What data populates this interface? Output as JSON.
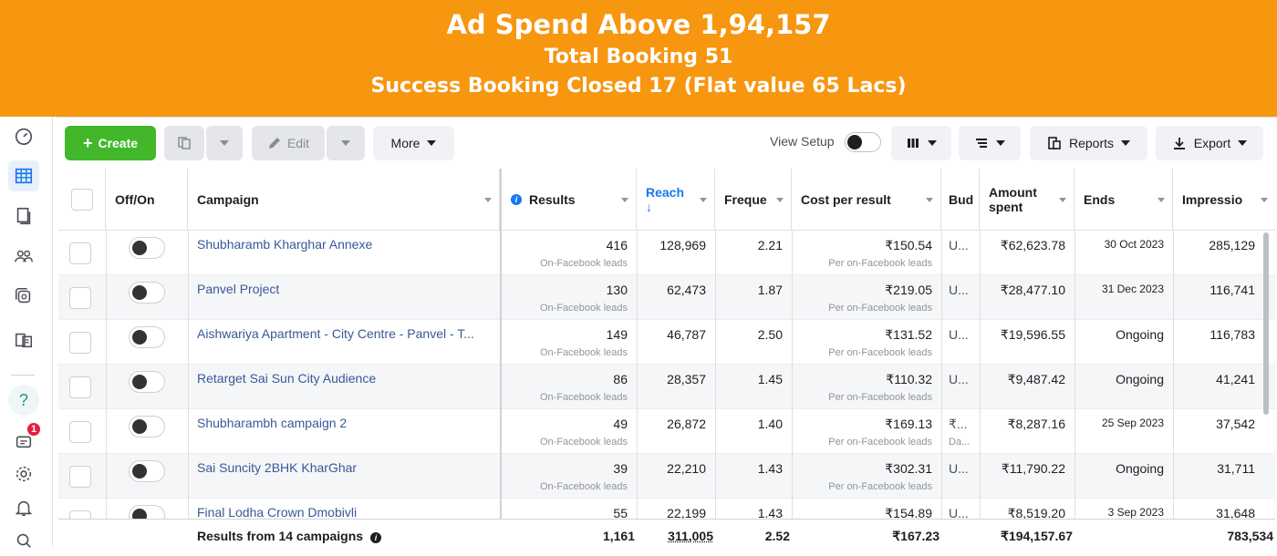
{
  "banner": {
    "line1": "Ad Spend Above 1,94,157",
    "line2": "Total Booking 51",
    "line3": "Success Booking Closed 17  (Flat value 65 Lacs)",
    "color": "#f7960f"
  },
  "leftnav": {
    "icons": [
      "gauge-icon",
      "table-grid-icon",
      "pages-icon",
      "audience-icon",
      "ad-stack-icon",
      "documents-icon",
      "help-icon",
      "notifications-icon",
      "gear-icon",
      "bell-icon",
      "search-icon"
    ],
    "badge_count": "1",
    "help_label": "?"
  },
  "toolbar": {
    "create_label": "Create",
    "edit_label": "Edit",
    "more_label": "More",
    "view_setup_label": "View Setup",
    "reports_label": "Reports",
    "export_label": "Export",
    "accent": "#42b72a"
  },
  "table": {
    "headers": {
      "offon": "Off/On",
      "campaign": "Campaign",
      "results": "Results",
      "reach": "Reach",
      "reach_arrow": "↓",
      "frequency": "Freque",
      "cost": "Cost per result",
      "budget": "Bud",
      "amount_line1": "Amount",
      "amount_line2": "spent",
      "ends": "Ends",
      "impressions": "Impressio"
    },
    "rows": [
      {
        "campaign": "Shubharamb Kharghar Annexe",
        "results": "416",
        "results_sub": "On-Facebook leads",
        "reach": "128,969",
        "frequency": "2.21",
        "cost": "₹150.54",
        "cost_sub": "Per on-Facebook leads",
        "budget": "U...",
        "budget_sub": "",
        "amount": "₹62,623.78",
        "ends": "30 Oct 2023",
        "impressions": "285,129"
      },
      {
        "campaign": "Panvel Project",
        "results": "130",
        "results_sub": "On-Facebook leads",
        "reach": "62,473",
        "frequency": "1.87",
        "cost": "₹219.05",
        "cost_sub": "Per on-Facebook leads",
        "budget": "U...",
        "budget_sub": "",
        "amount": "₹28,477.10",
        "ends": "31 Dec 2023",
        "impressions": "116,741"
      },
      {
        "campaign": "Aishwariya Apartment - City Centre - Panvel - T...",
        "results": "149",
        "results_sub": "On-Facebook leads",
        "reach": "46,787",
        "frequency": "2.50",
        "cost": "₹131.52",
        "cost_sub": "Per on-Facebook leads",
        "budget": "U...",
        "budget_sub": "",
        "amount": "₹19,596.55",
        "ends": "Ongoing",
        "impressions": "116,783"
      },
      {
        "campaign": "Retarget Sai Sun City Audience",
        "results": "86",
        "results_sub": "On-Facebook leads",
        "reach": "28,357",
        "frequency": "1.45",
        "cost": "₹110.32",
        "cost_sub": "Per on-Facebook leads",
        "budget": "U...",
        "budget_sub": "",
        "amount": "₹9,487.42",
        "ends": "Ongoing",
        "impressions": "41,241"
      },
      {
        "campaign": "Shubharambh campaign 2",
        "results": "49",
        "results_sub": "On-Facebook leads",
        "reach": "26,872",
        "frequency": "1.40",
        "cost": "₹169.13",
        "cost_sub": "Per on-Facebook leads",
        "budget": "₹...",
        "budget_sub": "Da...",
        "amount": "₹8,287.16",
        "ends": "25 Sep 2023",
        "impressions": "37,542"
      },
      {
        "campaign": "Sai Suncity 2BHK KharGhar",
        "results": "39",
        "results_sub": "On-Facebook leads",
        "reach": "22,210",
        "frequency": "1.43",
        "cost": "₹302.31",
        "cost_sub": "Per on-Facebook leads",
        "budget": "U...",
        "budget_sub": "",
        "amount": "₹11,790.22",
        "ends": "Ongoing",
        "impressions": "31,711"
      },
      {
        "campaign": "Final Lodha Crown Dmobivli",
        "results": "55",
        "results_sub": "",
        "reach": "22,199",
        "frequency": "1.43",
        "cost": "₹154.89",
        "cost_sub": "",
        "budget": "U...",
        "budget_sub": "",
        "amount": "₹8,519.20",
        "ends": "3 Sep 2023",
        "impressions": "31,648"
      }
    ],
    "footer": {
      "label": "Results from 14 campaigns",
      "results": "1,161",
      "reach": "311,005",
      "frequency": "2.52",
      "cost": "₹167.23",
      "amount": "₹194,157.67",
      "impressions": "783,534"
    }
  }
}
